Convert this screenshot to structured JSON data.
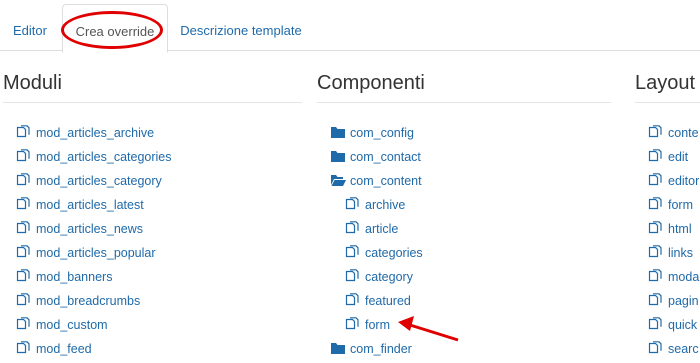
{
  "tabs": [
    {
      "label": "Editor"
    },
    {
      "label": "Crea override"
    },
    {
      "label": "Descrizione template"
    }
  ],
  "columns": {
    "moduli": {
      "title": "Moduli",
      "items": [
        "mod_articles_archive",
        "mod_articles_categories",
        "mod_articles_category",
        "mod_articles_latest",
        "mod_articles_news",
        "mod_articles_popular",
        "mod_banners",
        "mod_breadcrumbs",
        "mod_custom",
        "mod_feed"
      ]
    },
    "componenti": {
      "title": "Componenti",
      "items": [
        {
          "label": "com_config",
          "level": 0,
          "icon": "folder-icon"
        },
        {
          "label": "com_contact",
          "level": 0,
          "icon": "folder-icon"
        },
        {
          "label": "com_content",
          "level": 0,
          "icon": "folder-open-icon"
        },
        {
          "label": "archive",
          "level": 1,
          "icon": "files-icon"
        },
        {
          "label": "article",
          "level": 1,
          "icon": "files-icon"
        },
        {
          "label": "categories",
          "level": 1,
          "icon": "files-icon"
        },
        {
          "label": "category",
          "level": 1,
          "icon": "files-icon"
        },
        {
          "label": "featured",
          "level": 1,
          "icon": "files-icon"
        },
        {
          "label": "form",
          "level": 1,
          "icon": "files-icon"
        },
        {
          "label": "com_finder",
          "level": 0,
          "icon": "folder-icon"
        }
      ]
    },
    "layout": {
      "title": "Layout",
      "items": [
        "conte",
        "edit",
        "editor",
        "form",
        "html",
        "links",
        "moda",
        "pagin",
        "quick",
        "searc"
      ]
    }
  },
  "colors": {
    "link": "#1f6aa9",
    "annotation": "#e00000"
  }
}
